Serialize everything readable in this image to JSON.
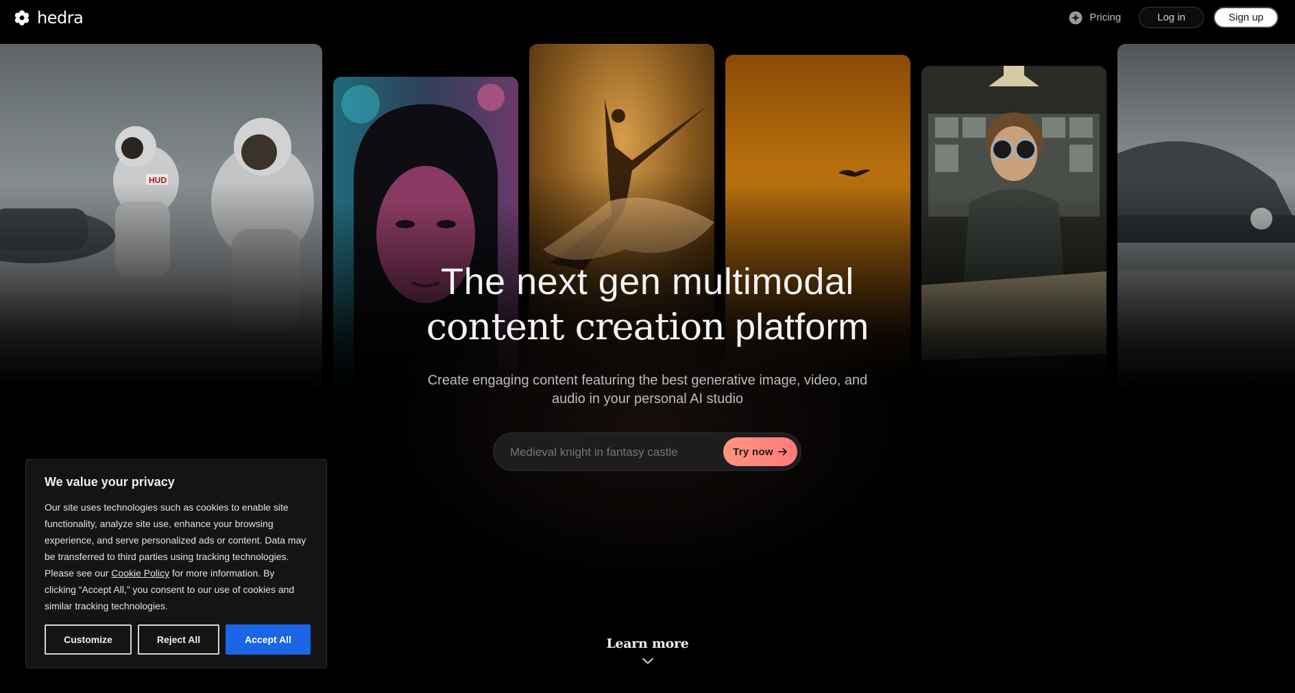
{
  "header": {
    "brand": "hedra",
    "nav": {
      "pricing_label": "Pricing",
      "login_label": "Log in",
      "signup_label": "Sign up"
    }
  },
  "hero": {
    "title_line1": "The next gen multimodal",
    "title_line2_emphasis": "content creation",
    "title_line2_rest": " platform",
    "subtitle_line1": "Create engaging content featuring the best generative image, video, and",
    "subtitle_line2": "audio in your personal AI studio"
  },
  "prompt": {
    "placeholder": "Medieval knight in fantasy castle",
    "button_label": "Try now"
  },
  "gallery": {
    "cards": [
      {
        "subject": "astronauts-on-snowy-planet",
        "badge": "HUD"
      },
      {
        "subject": "portrait-neon-lit-woman"
      },
      {
        "subject": "dancer-leaping-golden-light"
      },
      {
        "subject": "amber-sky-with-bird"
      },
      {
        "subject": "boy-with-goggles-holding-map"
      },
      {
        "subject": "snowy-dome-structure"
      }
    ]
  },
  "learn_more": {
    "label": "Learn more",
    "icon": "chevron-down-icon"
  },
  "cookie_banner": {
    "title": "We value your privacy",
    "body_before_link": "Our site uses technologies such as cookies to enable site functionality, analyze site use, enhance your browsing experience, and serve personalized ads or content. Data may be transferred to third parties using tracking technologies. Please see our ",
    "link_label": "Cookie Policy",
    "body_after_link": " for more information. By clicking “Accept All,” you consent to our use of cookies and similar tracking technologies.",
    "customize_label": "Customize",
    "reject_label": "Reject All",
    "accept_label": "Accept All",
    "accept_color": "#1a66e6"
  },
  "colors": {
    "background": "#000000",
    "try_button_gradient_start": "#ff9580",
    "try_button_gradient_end": "#ff7a7a"
  }
}
